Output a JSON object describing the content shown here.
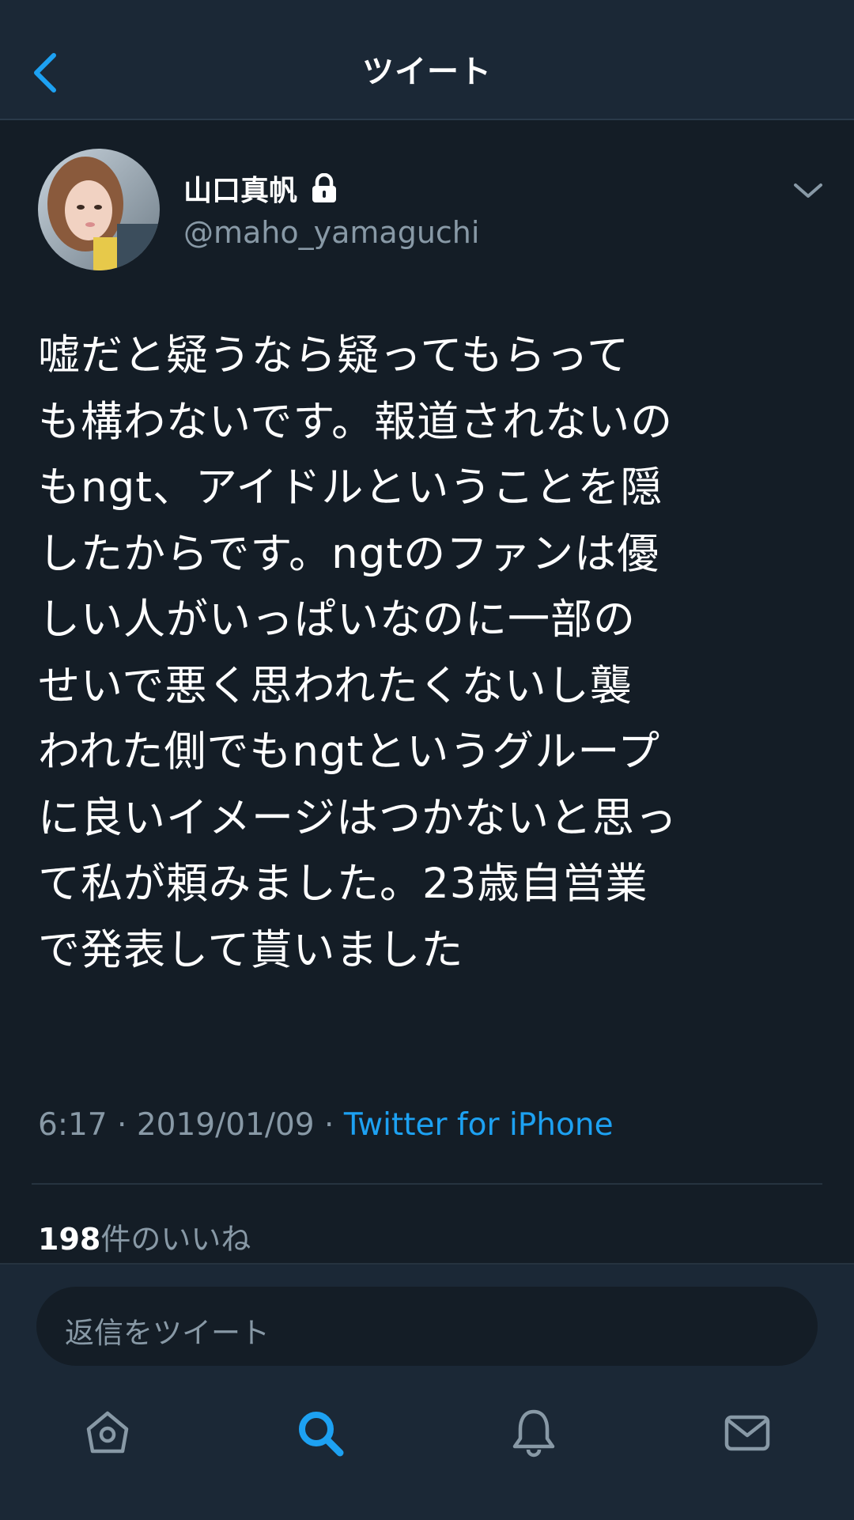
{
  "header": {
    "title": "ツイート"
  },
  "tweet": {
    "author_name": "山口真帆",
    "handle": "@maho_yamaguchi",
    "text": "嘘だと疑うなら疑ってもらって\nも構わないです。報道されないの\nもngt、アイドルということを隠\nしたからです。ngtのファンは優\nしい人がいっぱいなのに一部の\nせいで悪く思われたくないし襲\nわれた側でもngtというグループ\nに良いイメージはつかないと思っ\nて私が頼みました。23歳自営業\nで発表して貰いました",
    "time": "6:17",
    "date": "2019/01/09",
    "separator": "·",
    "source": "Twitter for iPhone",
    "likes_count": "198",
    "likes_label": "件のいいね"
  },
  "reply": {
    "placeholder": "返信をツイート"
  },
  "tabs": [
    {
      "icon": "home-icon"
    },
    {
      "icon": "search-icon",
      "active": true
    },
    {
      "icon": "notifications-icon"
    },
    {
      "icon": "messages-icon"
    }
  ],
  "colors": {
    "background": "#141d26",
    "bar": "#1b2836",
    "accent": "#1da1f2",
    "secondary_text": "#8899a6"
  }
}
